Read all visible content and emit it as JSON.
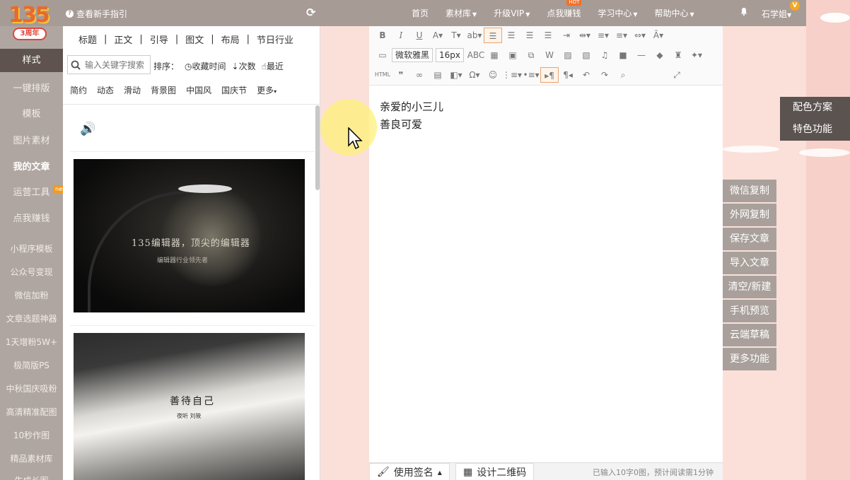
{
  "logo": {
    "text": "135",
    "badge": "3周年"
  },
  "topbar": {
    "guide": "查看新手指引",
    "nav": [
      {
        "label": "首页",
        "dropdown": false
      },
      {
        "label": "素材库",
        "dropdown": true
      },
      {
        "label": "升级VIP",
        "dropdown": true
      },
      {
        "label": "点我赚钱",
        "dropdown": false,
        "badge": "HOT"
      },
      {
        "label": "学习中心",
        "dropdown": true
      },
      {
        "label": "帮助中心",
        "dropdown": true
      }
    ],
    "user": "石学姐",
    "vip_badge": "V"
  },
  "sidebar": {
    "items": [
      "样式",
      "一键排版",
      "模板",
      "图片素材",
      "我的文章",
      "运营工具",
      "点我赚钱",
      "小程序模板",
      "公众号变现",
      "微信加粉",
      "文章选题神器",
      "1天增粉5W+",
      "极简版PS",
      "中秋国庆吸粉",
      "高清精准配图",
      "10秒作图",
      "精品素材库",
      "生成长图"
    ],
    "new_badge": "new"
  },
  "panel": {
    "categories": [
      "标题",
      "正文",
      "引导",
      "图文",
      "布局",
      "节日行业"
    ],
    "search_placeholder": "输入关键字搜索",
    "sort_label": "排序：",
    "sort_options": [
      "收藏时间",
      "次数",
      "最近"
    ],
    "tags": [
      "简约",
      "动态",
      "滑动",
      "背景图",
      "中国风",
      "国庆节",
      "更多"
    ],
    "image1": {
      "line1": "135编辑器，顶尖的编辑器",
      "line2": "编辑器行业领先者"
    },
    "image2": {
      "line1": "善待自己",
      "line2": "夜听 刘筱"
    }
  },
  "editor": {
    "font_family": "微软雅黑",
    "font_size": "16px",
    "content": [
      "亲爱的小三儿",
      "善良可爱"
    ],
    "signature_button": "使用签名",
    "qrcode_button": "设计二维码",
    "status_text": "已输入10字0图，预计阅读需1分钟"
  },
  "right_actions": [
    "微信复制",
    "外网复制",
    "保存文章",
    "导入文章",
    "清空/新建",
    "手机预览",
    "云端草稿",
    "更多功能"
  ],
  "color_panel": [
    "配色方案",
    "特色功能"
  ]
}
